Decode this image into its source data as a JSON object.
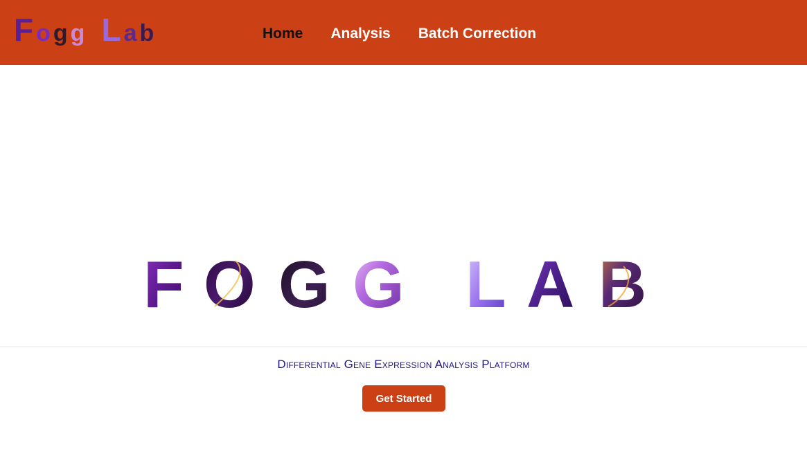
{
  "navbar": {
    "logo": {
      "letters": [
        "F",
        "o",
        "g",
        "g",
        "L",
        "a",
        "b"
      ]
    },
    "links": [
      {
        "label": "Home",
        "active": true
      },
      {
        "label": "Analysis",
        "active": false
      },
      {
        "label": "Batch Correction",
        "active": false
      }
    ]
  },
  "hero": {
    "logo_letters": [
      "F",
      "O",
      "G",
      "G",
      "L",
      "A",
      "B"
    ],
    "tagline": "Differential Gene Expression Analysis Platform",
    "cta_label": "Get Started"
  },
  "colors": {
    "nav_bg": "#cc4016",
    "nav_text": "#ffffff",
    "nav_active_text": "#111111",
    "tagline": "#1f1780",
    "button_bg": "#cc4016",
    "logo_gradient": [
      "#5a1a8a",
      "#7d3ad6",
      "#2a0d47",
      "#b77cf2"
    ]
  }
}
